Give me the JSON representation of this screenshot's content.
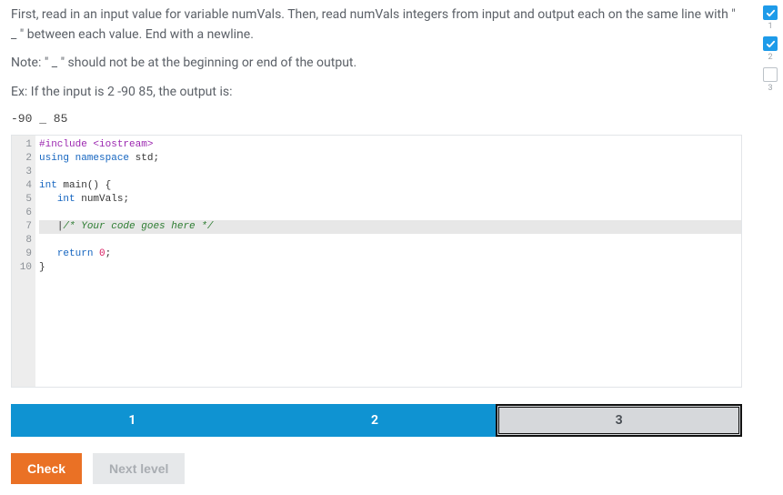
{
  "problem": {
    "p1": "First, read in an input value for variable numVals. Then, read numVals integers from input and output each on the same line with \" _ \" between each value. End with a newline.",
    "p2": "Note: \" _ \" should not be at the beginning or end of the output.",
    "p3": "Ex: If the input is 2 -90 85, the output is:",
    "output": "-90 _ 85"
  },
  "code": {
    "lines": [
      {
        "n": "1",
        "segs": [
          {
            "t": "#include ",
            "c": "tok-pp"
          },
          {
            "t": "<iostream>",
            "c": "tok-pp"
          }
        ]
      },
      {
        "n": "2",
        "segs": [
          {
            "t": "using ",
            "c": "tok-kw"
          },
          {
            "t": "namespace ",
            "c": "tok-kw"
          },
          {
            "t": "std",
            "c": "tok-id"
          },
          {
            "t": ";",
            "c": "tok-punct"
          }
        ]
      },
      {
        "n": "3",
        "segs": []
      },
      {
        "n": "4",
        "segs": [
          {
            "t": "int ",
            "c": "tok-kw"
          },
          {
            "t": "main",
            "c": "tok-id"
          },
          {
            "t": "() {",
            "c": "tok-punct"
          }
        ]
      },
      {
        "n": "5",
        "segs": [
          {
            "t": "   ",
            "c": ""
          },
          {
            "t": "int ",
            "c": "tok-kw"
          },
          {
            "t": "numVals",
            "c": "tok-id"
          },
          {
            "t": ";",
            "c": "tok-punct"
          }
        ]
      },
      {
        "n": "6",
        "segs": []
      },
      {
        "n": "7",
        "hl": true,
        "segs": [
          {
            "t": "   ",
            "c": ""
          },
          {
            "t": "|",
            "c": "tok-punct"
          },
          {
            "t": "/* Your code goes here */",
            "c": "tok-cm"
          }
        ]
      },
      {
        "n": "8",
        "segs": []
      },
      {
        "n": "9",
        "segs": [
          {
            "t": "   ",
            "c": ""
          },
          {
            "t": "return ",
            "c": "tok-kw"
          },
          {
            "t": "0",
            "c": "tok-num"
          },
          {
            "t": ";",
            "c": "tok-punct"
          }
        ]
      },
      {
        "n": "10",
        "segs": [
          {
            "t": "}",
            "c": "tok-punct"
          }
        ]
      }
    ]
  },
  "tabs": [
    {
      "label": "1",
      "active": false
    },
    {
      "label": "2",
      "active": false
    },
    {
      "label": "3",
      "active": true
    }
  ],
  "buttons": {
    "check": "Check",
    "next": "Next level"
  },
  "side_progress": [
    {
      "label": "1",
      "done": true
    },
    {
      "label": "2",
      "done": true
    },
    {
      "label": "3",
      "done": false
    }
  ]
}
